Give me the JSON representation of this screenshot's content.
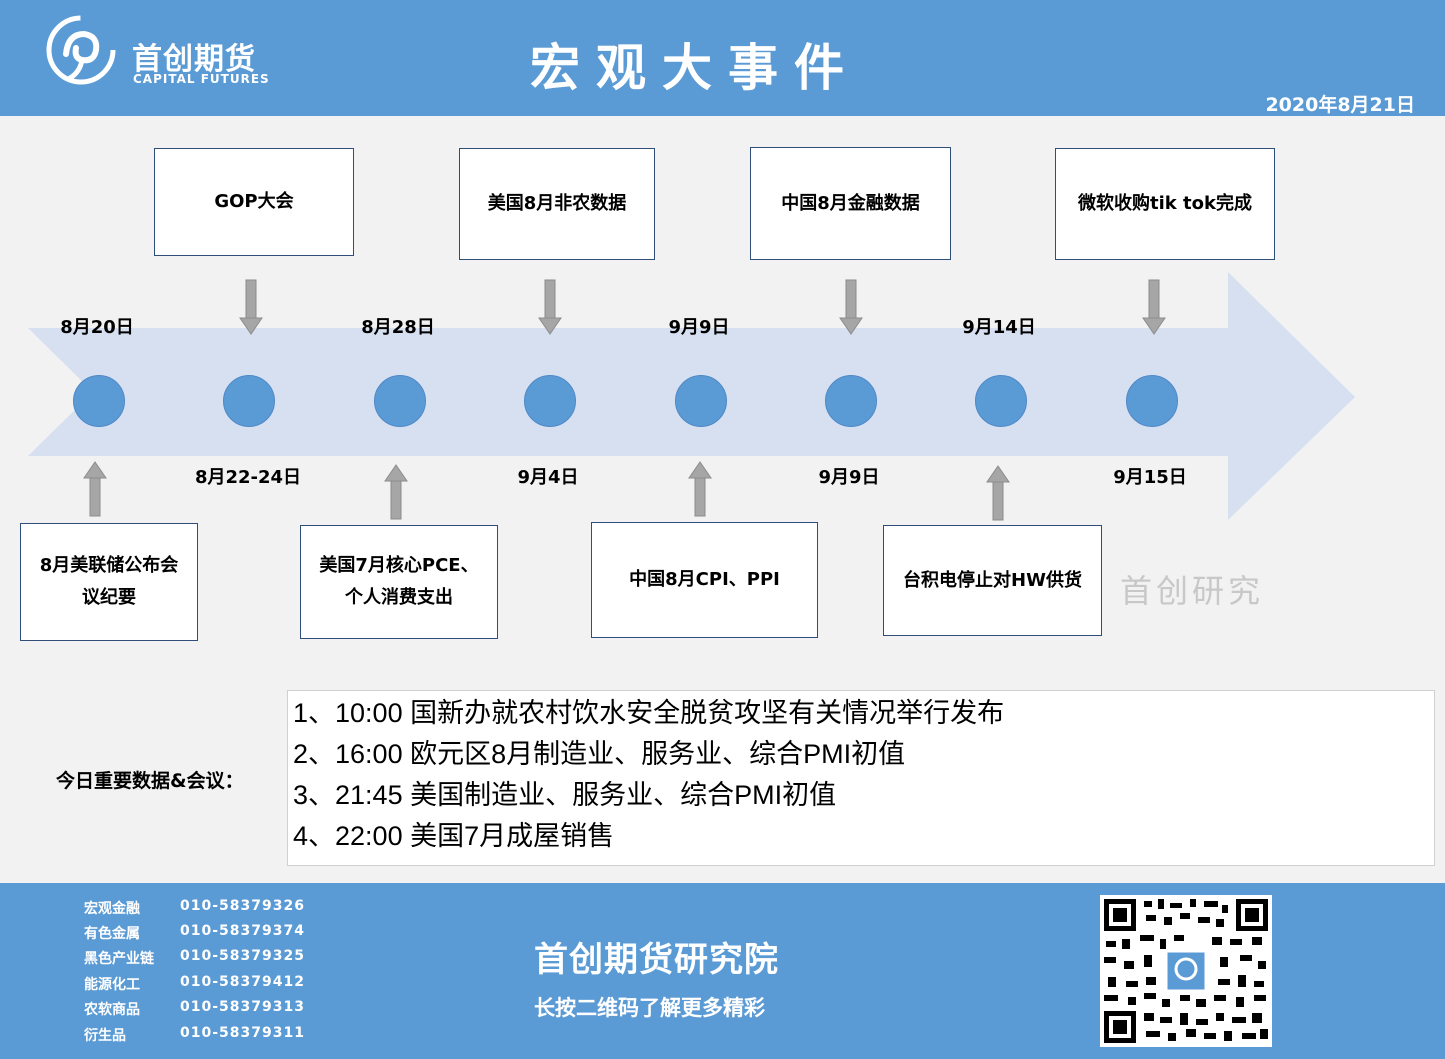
{
  "header": {
    "logo_text": "首创期货",
    "logo_sub": "CAPITAL FUTURES",
    "title": "宏观大事件",
    "date": "2020年8月21日"
  },
  "timeline": {
    "top_dates": [
      "8月20日",
      "8月28日",
      "9月9日",
      "9月14日"
    ],
    "bottom_dates": [
      "8月22-24日",
      "9月4日",
      "9月9日",
      "9月15日"
    ],
    "top_events": [
      "GOP大会",
      "美国8月非农数据",
      "中国8月金融数据",
      "微软收购tik tok完成"
    ],
    "bottom_events": [
      "8月美联储公布会议纪要",
      "美国7月核心PCE、个人消费支出",
      "中国8月CPI、PPI",
      "台积电停止对HW供货"
    ],
    "watermark": "首创研究"
  },
  "today": {
    "label": "今日重要数据&会议：",
    "items": [
      "1、10:00 国新办就农村饮水安全脱贫攻坚有关情况举行发布",
      "2、16:00 欧元区8月制造业、服务业、综合PMI初值",
      "3、21:45 美国制造业、服务业、综合PMI初值",
      "4、22:00 美国7月成屋销售"
    ]
  },
  "footer": {
    "contacts": [
      {
        "dept": "宏观金融",
        "phone": "010-58379326"
      },
      {
        "dept": "有色金属",
        "phone": "010-58379374"
      },
      {
        "dept": "黑色产业链",
        "phone": "010-58379325"
      },
      {
        "dept": "能源化工",
        "phone": "010-58379412"
      },
      {
        "dept": "农软商品",
        "phone": "010-58379313"
      },
      {
        "dept": "衍生品",
        "phone": "010-58379311"
      }
    ],
    "institute": "首创期货研究院",
    "slogan": "长按二维码了解更多精彩"
  },
  "colors": {
    "brand": "#5b9bd5",
    "arrow": "#d6e0f0",
    "dot": "#5b9bd5"
  }
}
